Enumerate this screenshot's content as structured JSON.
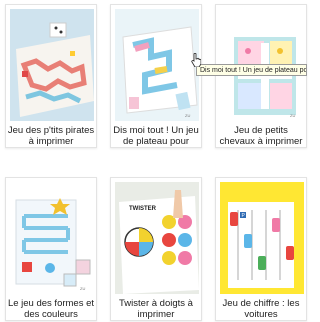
{
  "cards": [
    {
      "title": "Jeu des p'tits pirates à imprimer",
      "thumb": "pirate-board-game-image"
    },
    {
      "title": "Dis moi tout ! Un jeu de plateau pour papoter",
      "thumb": "conversation-board-game-image"
    },
    {
      "title": "Jeu de petits chevaux à imprimer version Licornes !",
      "thumb": "unicorn-horse-game-image"
    },
    {
      "title": "Le jeu des formes et des couleurs",
      "thumb": "shapes-colors-game-image"
    },
    {
      "title": "Twister à doigts à imprimer",
      "thumb": "finger-twister-image"
    },
    {
      "title": "Jeu de chiffre : les voitures",
      "thumb": "cars-number-game-image"
    }
  ],
  "tooltip": "Dis moi tout ! Un jeu de plateau pour papoter",
  "watermark": "ZU",
  "twister_label": "TWISTER",
  "colors": {
    "pink": "#f07aa6",
    "blue": "#5bb6e8",
    "yellow": "#f2d22e",
    "red": "#e8463f",
    "green": "#4cae5a"
  }
}
